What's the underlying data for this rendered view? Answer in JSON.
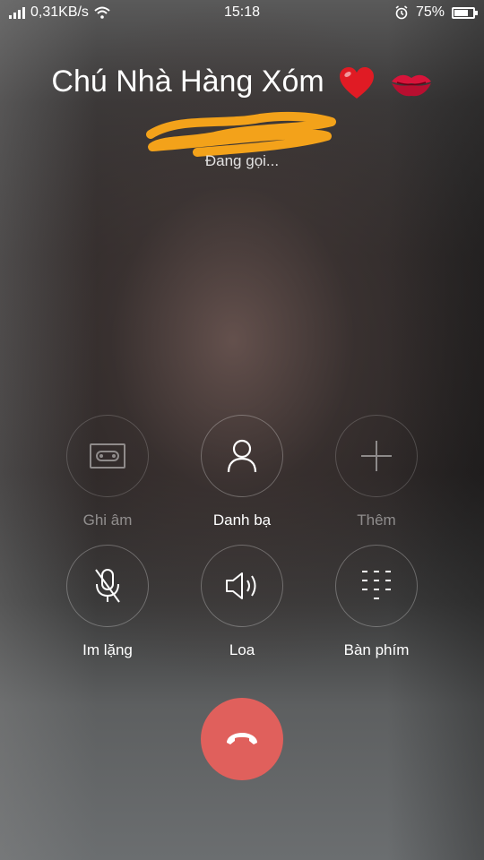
{
  "status_bar": {
    "network_speed": "0,31KB/s",
    "time": "15:18",
    "battery_percent": "75%",
    "battery_level": 0.75,
    "icons": [
      "signal-icon",
      "wifi-icon",
      "alarm-icon",
      "battery-icon"
    ]
  },
  "call": {
    "contact_name": "Chú Nhà Hàng Xóm",
    "emojis": [
      "red-heart-emoji",
      "kiss-mark-emoji"
    ],
    "status": "Đang gọi..."
  },
  "controls": [
    {
      "label": "Ghi âm",
      "icon": "record-icon",
      "enabled": false
    },
    {
      "label": "Danh bạ",
      "icon": "contact-icon",
      "enabled": true
    },
    {
      "label": "Thêm",
      "icon": "add-icon",
      "enabled": false
    },
    {
      "label": "Im lặng",
      "icon": "mute-mic-icon",
      "enabled": true
    },
    {
      "label": "Loa",
      "icon": "speaker-icon",
      "enabled": true
    },
    {
      "label": "Bàn phím",
      "icon": "keypad-icon",
      "enabled": true
    }
  ],
  "end_call": {
    "icon": "end-call-icon",
    "color": "#e0605c"
  }
}
